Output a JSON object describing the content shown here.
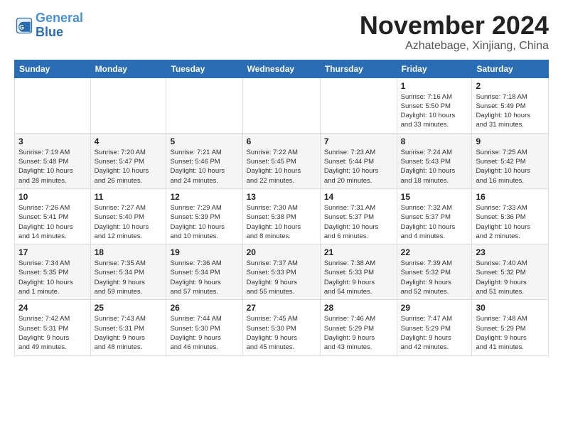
{
  "header": {
    "logo_line1": "General",
    "logo_line2": "Blue",
    "month_title": "November 2024",
    "subtitle": "Azhatebage, Xinjiang, China"
  },
  "days_of_week": [
    "Sunday",
    "Monday",
    "Tuesday",
    "Wednesday",
    "Thursday",
    "Friday",
    "Saturday"
  ],
  "weeks": [
    {
      "days": [
        {
          "num": "",
          "info": ""
        },
        {
          "num": "",
          "info": ""
        },
        {
          "num": "",
          "info": ""
        },
        {
          "num": "",
          "info": ""
        },
        {
          "num": "",
          "info": ""
        },
        {
          "num": "1",
          "info": "Sunrise: 7:16 AM\nSunset: 5:50 PM\nDaylight: 10 hours\nand 33 minutes."
        },
        {
          "num": "2",
          "info": "Sunrise: 7:18 AM\nSunset: 5:49 PM\nDaylight: 10 hours\nand 31 minutes."
        }
      ]
    },
    {
      "days": [
        {
          "num": "3",
          "info": "Sunrise: 7:19 AM\nSunset: 5:48 PM\nDaylight: 10 hours\nand 28 minutes."
        },
        {
          "num": "4",
          "info": "Sunrise: 7:20 AM\nSunset: 5:47 PM\nDaylight: 10 hours\nand 26 minutes."
        },
        {
          "num": "5",
          "info": "Sunrise: 7:21 AM\nSunset: 5:46 PM\nDaylight: 10 hours\nand 24 minutes."
        },
        {
          "num": "6",
          "info": "Sunrise: 7:22 AM\nSunset: 5:45 PM\nDaylight: 10 hours\nand 22 minutes."
        },
        {
          "num": "7",
          "info": "Sunrise: 7:23 AM\nSunset: 5:44 PM\nDaylight: 10 hours\nand 20 minutes."
        },
        {
          "num": "8",
          "info": "Sunrise: 7:24 AM\nSunset: 5:43 PM\nDaylight: 10 hours\nand 18 minutes."
        },
        {
          "num": "9",
          "info": "Sunrise: 7:25 AM\nSunset: 5:42 PM\nDaylight: 10 hours\nand 16 minutes."
        }
      ]
    },
    {
      "days": [
        {
          "num": "10",
          "info": "Sunrise: 7:26 AM\nSunset: 5:41 PM\nDaylight: 10 hours\nand 14 minutes."
        },
        {
          "num": "11",
          "info": "Sunrise: 7:27 AM\nSunset: 5:40 PM\nDaylight: 10 hours\nand 12 minutes."
        },
        {
          "num": "12",
          "info": "Sunrise: 7:29 AM\nSunset: 5:39 PM\nDaylight: 10 hours\nand 10 minutes."
        },
        {
          "num": "13",
          "info": "Sunrise: 7:30 AM\nSunset: 5:38 PM\nDaylight: 10 hours\nand 8 minutes."
        },
        {
          "num": "14",
          "info": "Sunrise: 7:31 AM\nSunset: 5:37 PM\nDaylight: 10 hours\nand 6 minutes."
        },
        {
          "num": "15",
          "info": "Sunrise: 7:32 AM\nSunset: 5:37 PM\nDaylight: 10 hours\nand 4 minutes."
        },
        {
          "num": "16",
          "info": "Sunrise: 7:33 AM\nSunset: 5:36 PM\nDaylight: 10 hours\nand 2 minutes."
        }
      ]
    },
    {
      "days": [
        {
          "num": "17",
          "info": "Sunrise: 7:34 AM\nSunset: 5:35 PM\nDaylight: 10 hours\nand 1 minute."
        },
        {
          "num": "18",
          "info": "Sunrise: 7:35 AM\nSunset: 5:34 PM\nDaylight: 9 hours\nand 59 minutes."
        },
        {
          "num": "19",
          "info": "Sunrise: 7:36 AM\nSunset: 5:34 PM\nDaylight: 9 hours\nand 57 minutes."
        },
        {
          "num": "20",
          "info": "Sunrise: 7:37 AM\nSunset: 5:33 PM\nDaylight: 9 hours\nand 55 minutes."
        },
        {
          "num": "21",
          "info": "Sunrise: 7:38 AM\nSunset: 5:33 PM\nDaylight: 9 hours\nand 54 minutes."
        },
        {
          "num": "22",
          "info": "Sunrise: 7:39 AM\nSunset: 5:32 PM\nDaylight: 9 hours\nand 52 minutes."
        },
        {
          "num": "23",
          "info": "Sunrise: 7:40 AM\nSunset: 5:32 PM\nDaylight: 9 hours\nand 51 minutes."
        }
      ]
    },
    {
      "days": [
        {
          "num": "24",
          "info": "Sunrise: 7:42 AM\nSunset: 5:31 PM\nDaylight: 9 hours\nand 49 minutes."
        },
        {
          "num": "25",
          "info": "Sunrise: 7:43 AM\nSunset: 5:31 PM\nDaylight: 9 hours\nand 48 minutes."
        },
        {
          "num": "26",
          "info": "Sunrise: 7:44 AM\nSunset: 5:30 PM\nDaylight: 9 hours\nand 46 minutes."
        },
        {
          "num": "27",
          "info": "Sunrise: 7:45 AM\nSunset: 5:30 PM\nDaylight: 9 hours\nand 45 minutes."
        },
        {
          "num": "28",
          "info": "Sunrise: 7:46 AM\nSunset: 5:29 PM\nDaylight: 9 hours\nand 43 minutes."
        },
        {
          "num": "29",
          "info": "Sunrise: 7:47 AM\nSunset: 5:29 PM\nDaylight: 9 hours\nand 42 minutes."
        },
        {
          "num": "30",
          "info": "Sunrise: 7:48 AM\nSunset: 5:29 PM\nDaylight: 9 hours\nand 41 minutes."
        }
      ]
    }
  ]
}
